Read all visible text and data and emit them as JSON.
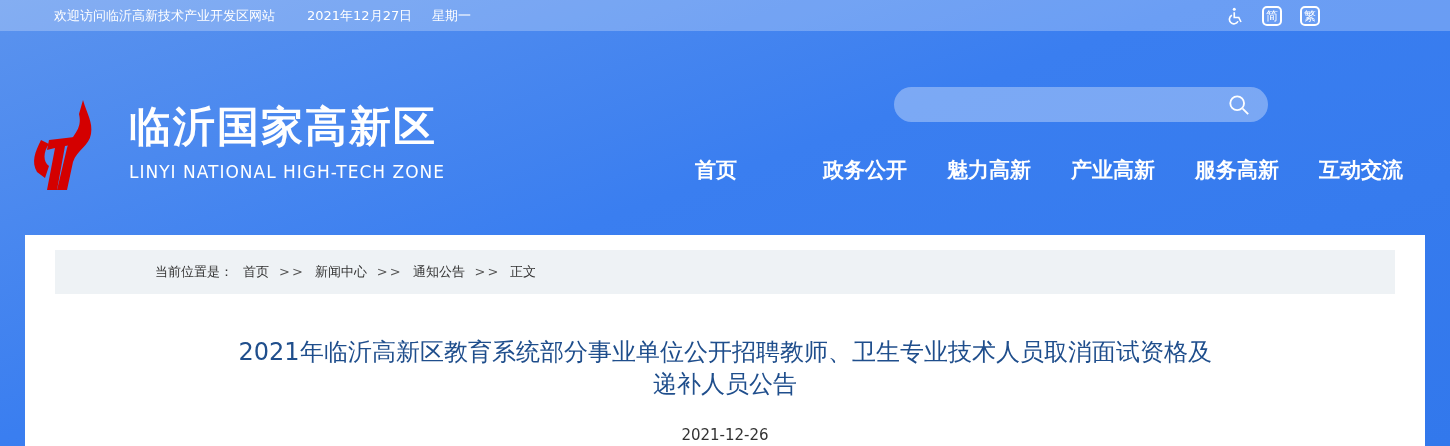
{
  "top_bar": {
    "welcome": "欢迎访问临沂高新技术产业开发区网站",
    "date": "2021年12月27日",
    "weekday": "星期一",
    "language_buttons": [
      "简",
      "繁"
    ]
  },
  "header": {
    "site_name": "临沂国家高新区",
    "site_name_en": "LINYI NATIONAL HIGH-TECH ZONE"
  },
  "nav": [
    "首页",
    "政务公开",
    "魅力高新",
    "产业高新",
    "服务高新",
    "互动交流"
  ],
  "breadcrumb": {
    "label": "当前位置是：",
    "items": [
      {
        "kind": "link",
        "text": "首页"
      },
      {
        "kind": "separator",
        "text": ">>"
      },
      {
        "kind": "link",
        "text": "新闻中心"
      },
      {
        "kind": "separator",
        "text": ">>"
      },
      {
        "kind": "link",
        "text": "通知公告"
      },
      {
        "kind": "separator",
        "text": ">>"
      },
      {
        "kind": "link",
        "text": "正文"
      }
    ]
  },
  "article": {
    "title": "2021年临沂高新区教育系统部分事业单位公开招聘教师、卫生专业技术人员取消面试资格及递补人员公告",
    "date": "2021-12-26"
  }
}
